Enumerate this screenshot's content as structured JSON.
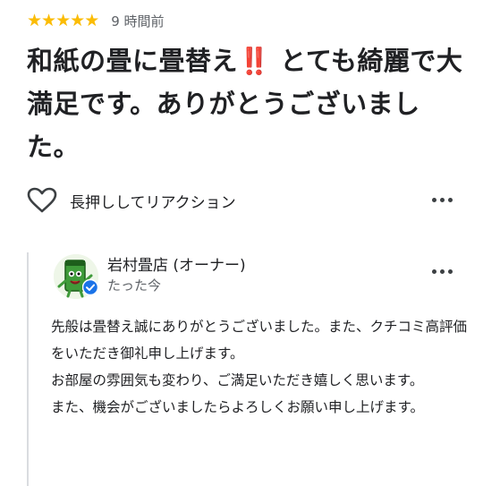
{
  "review": {
    "stars": [
      "★",
      "★",
      "★",
      "★",
      "★"
    ],
    "rating": 5,
    "time": "9 時間前",
    "text_part1": "和紙の畳に畳替え",
    "emphasis": "‼️",
    "text_part2": " とても綺麗で大満足です。ありがとうございました。"
  },
  "reaction": {
    "label": "長押ししてリアクション",
    "icon": "heart-icon"
  },
  "owner_reply": {
    "name": "岩村畳店 (オーナー)",
    "time": "たった今",
    "text": "先般は畳替え誠にありがとうございました。また、クチコミ高評価をいただき御礼申し上げます。\nお部屋の雰囲気も変わり、ご満足いただき嬉しく思います。\nまた、機会がございましたらよろしくお願い申し上げます。"
  },
  "colors": {
    "star": "#fbbc04",
    "verified": "#1a73e8",
    "emphasis": "#d93025"
  }
}
